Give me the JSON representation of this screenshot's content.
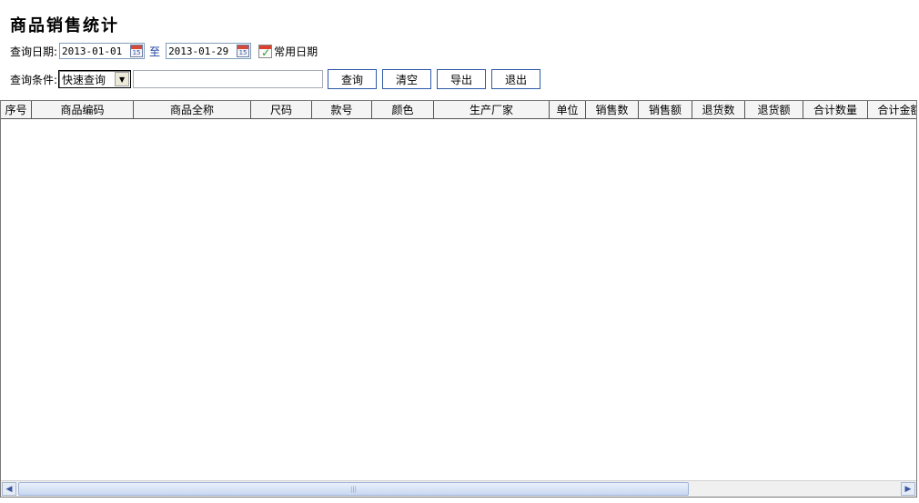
{
  "page": {
    "title": "商品销售统计"
  },
  "query": {
    "date_label": "查询日期:",
    "date_from": "2013-01-01",
    "to_label": "至",
    "date_to": "2013-01-29",
    "common_date_label": "常用日期",
    "condition_label": "查询条件:",
    "condition_selected": "快速查询",
    "condition_value": "",
    "calendar_icon_text": "15"
  },
  "buttons": {
    "search": "查询",
    "clear": "清空",
    "export": "导出",
    "exit": "退出"
  },
  "table": {
    "columns": [
      "序号",
      "商品编码",
      "商品全称",
      "尺码",
      "款号",
      "颜色",
      "生产厂家",
      "单位",
      "销售数",
      "销售额",
      "退货数",
      "退货额",
      "合计数量",
      "合计金额"
    ],
    "rows": []
  },
  "scrollbar": {
    "left_arrow": "◀",
    "right_arrow": "▶",
    "grip": "|||"
  }
}
